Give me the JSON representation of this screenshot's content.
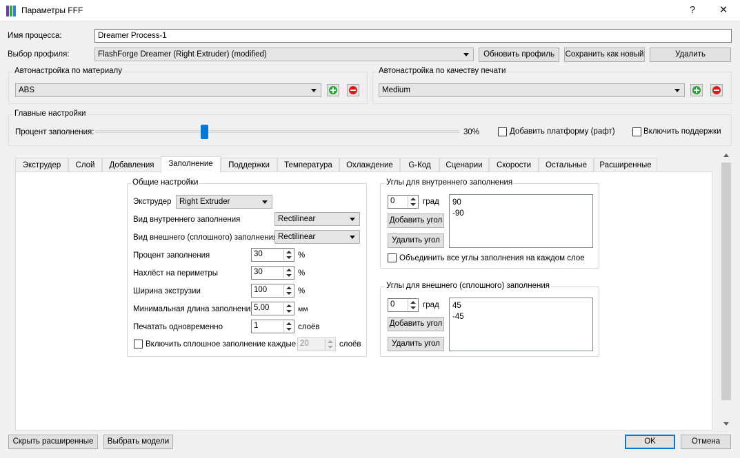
{
  "window": {
    "title": "Параметры FFF",
    "help_glyph": "?",
    "close_glyph": "✕",
    "icon": "fff-app-icon",
    "icon_colors": [
      "#6b3fa0",
      "#3aa64a",
      "#2f7fd1"
    ]
  },
  "process": {
    "label": "Имя процесса:",
    "value": "Dreamer Process-1"
  },
  "profile": {
    "label": "Выбор профиля:",
    "value": "FlashForge Dreamer (Right Extruder) (modified)",
    "update_button": "Обновить профиль",
    "save_new_button": "Сохранить как новый",
    "delete_button": "Удалить"
  },
  "material_autoconfig": {
    "title": "Автонастройка по  материалу",
    "value": "ABS"
  },
  "quality_autoconfig": {
    "title": "Автонастройка по качеству печати",
    "value": "Medium"
  },
  "main_settings": {
    "title": "Главные настройки",
    "infill_label": "Процент заполнения:",
    "infill_value": "30%",
    "infill_fraction": 0.3,
    "raft_label": "Добавить платформу (рафт)",
    "raft_checked": false,
    "supports_label": "Включить поддержки",
    "supports_checked": false
  },
  "tabs": [
    "Экструдер",
    "Слой",
    "Добавления",
    "Заполнение",
    "Поддержки",
    "Температура",
    "Охлаждение",
    "G-Код",
    "Сценарии",
    "Скорости",
    "Остальные",
    "Расширенные"
  ],
  "active_tab": "Заполнение",
  "general": {
    "title": "Общие настройки",
    "extruder_label": "Экструдер",
    "extruder_value": "Right Extruder",
    "internal_fill_label": "Вид внутреннего заполнения",
    "internal_fill_value": "Rectilinear",
    "external_fill_label": "Вид внешнего (сплошного) заполнения",
    "external_fill_value": "Rectilinear",
    "infill_percent_label": "Процент заполнения",
    "infill_percent_value": "30",
    "infill_percent_unit": "%",
    "overlap_label": "Нахлёст на периметры",
    "overlap_value": "30",
    "overlap_unit": "%",
    "extrusion_width_label": "Ширина экструзии",
    "extrusion_width_value": "100",
    "extrusion_width_unit": "%",
    "min_length_label": "Минимальная длина заполнения",
    "min_length_value": "5,00",
    "min_length_unit": "мм",
    "print_together_label": "Печатать одновременно",
    "print_together_value": "1",
    "print_together_unit": "слоёв",
    "solid_every_label": "Включить сплошное заполнение каждые",
    "solid_every_checked": false,
    "solid_every_value": "20",
    "solid_every_unit": "слоёв"
  },
  "internal_angles": {
    "title": "Углы для внутреннего заполнения",
    "angle_value": "0",
    "angle_unit": "град",
    "add_button": "Добавить угол",
    "remove_button": "Удалить угол",
    "angles": [
      "90",
      "-90"
    ],
    "combine_label": "Объединить все углы заполнения на каждом слое",
    "combine_checked": false
  },
  "external_angles": {
    "title": "Углы для внешнего (сплошного) заполнения",
    "angle_value": "0",
    "angle_unit": "град",
    "add_button": "Добавить угол",
    "remove_button": "Удалить угол",
    "angles": [
      "45",
      "-45"
    ]
  },
  "footer": {
    "hide_advanced_button": "Скрыть расширенные",
    "select_models_button": "Выбрать модели",
    "ok_button": "OK",
    "cancel_button": "Отмена"
  },
  "colors": {
    "accent": "#0078d7",
    "add": "#22a433",
    "remove": "#e0161b"
  }
}
